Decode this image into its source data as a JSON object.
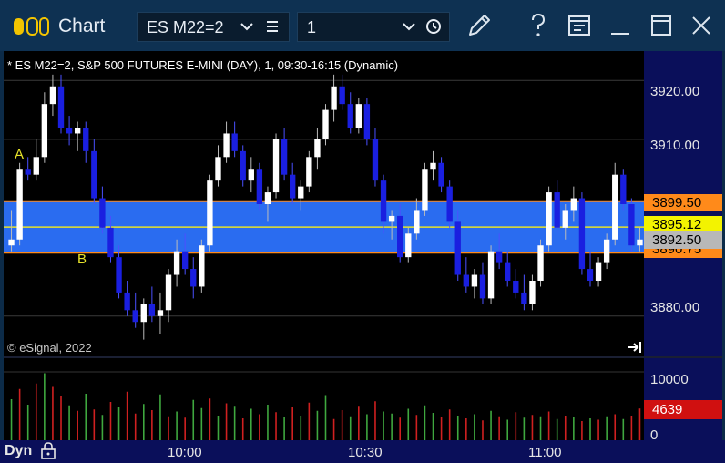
{
  "window": {
    "title": "Chart"
  },
  "toolbar": {
    "symbol": "ES M22=2",
    "interval": "1",
    "icons": [
      "chevron-down-icon",
      "list-icon",
      "chevron-down-icon",
      "clock-icon",
      "pencil-icon",
      "help-icon",
      "layout-icon",
      "minimize-icon",
      "maximize-icon",
      "close-icon"
    ]
  },
  "chart": {
    "study_title": "* ES M22=2, S&P 500 FUTURES E-MINI (DAY), 1, 09:30-16:15 (Dynamic)",
    "copyright": "© eSignal, 2022",
    "annotations": {
      "a": "A",
      "b": "B"
    },
    "price_labels": [
      "3920.00",
      "3910.00",
      "3880.00"
    ],
    "tags": {
      "upper": "3899.50",
      "middle": "3895.12",
      "last": "3892.50",
      "lower_partial": "3890.75"
    },
    "volume_labels": {
      "max": "10000",
      "last": "4639",
      "zero": "0"
    },
    "time_labels": [
      "10:00",
      "10:30",
      "11:00"
    ],
    "footer_mode": "Dyn",
    "colors": {
      "up": "#ffffff",
      "down": "#1a1fe0",
      "band": "#2a6cf0",
      "band_edge": "#ff8a1a",
      "midline": "#e7e32a",
      "vol_up": "#3fa83f",
      "vol_down": "#d02020"
    }
  },
  "chart_data": {
    "type": "candlestick",
    "ylim": [
      3873,
      3925
    ],
    "band": {
      "top": 3899.5,
      "bottom": 3890.75,
      "mid": 3895.12
    },
    "candles": [
      [
        3892,
        3898,
        3891,
        3893
      ],
      [
        3893,
        3906,
        3892,
        3905
      ],
      [
        3905,
        3907,
        3903,
        3904
      ],
      [
        3904,
        3910,
        3903,
        3907
      ],
      [
        3907,
        3918,
        3906,
        3916
      ],
      [
        3916,
        3921,
        3914,
        3919
      ],
      [
        3919,
        3921,
        3911,
        3912
      ],
      [
        3912,
        3914,
        3909,
        3911
      ],
      [
        3911,
        3913,
        3908,
        3912
      ],
      [
        3912,
        3913,
        3906,
        3908
      ],
      [
        3908,
        3910,
        3899,
        3900
      ],
      [
        3900,
        3902,
        3894,
        3895
      ],
      [
        3895,
        3897,
        3889,
        3890
      ],
      [
        3890,
        3892,
        3883,
        3884
      ],
      [
        3884,
        3886,
        3880,
        3881
      ],
      [
        3881,
        3884,
        3878,
        3879
      ],
      [
        3879,
        3883,
        3876,
        3882
      ],
      [
        3882,
        3885,
        3879,
        3880
      ],
      [
        3880,
        3884,
        3877,
        3881
      ],
      [
        3881,
        3888,
        3879,
        3887
      ],
      [
        3887,
        3893,
        3885,
        3891
      ],
      [
        3891,
        3894,
        3887,
        3888
      ],
      [
        3888,
        3890,
        3883,
        3885
      ],
      [
        3885,
        3893,
        3884,
        3892
      ],
      [
        3892,
        3904,
        3891,
        3903
      ],
      [
        3903,
        3909,
        3902,
        3907
      ],
      [
        3907,
        3913,
        3906,
        3911
      ],
      [
        3911,
        3913,
        3907,
        3908
      ],
      [
        3908,
        3909,
        3902,
        3903
      ],
      [
        3903,
        3907,
        3901,
        3905
      ],
      [
        3905,
        3906,
        3898,
        3899
      ],
      [
        3899,
        3902,
        3896,
        3901
      ],
      [
        3901,
        3911,
        3900,
        3910
      ],
      [
        3910,
        3912,
        3903,
        3904
      ],
      [
        3904,
        3906,
        3899,
        3900
      ],
      [
        3900,
        3903,
        3898,
        3902
      ],
      [
        3902,
        3908,
        3901,
        3907
      ],
      [
        3907,
        3912,
        3905,
        3910
      ],
      [
        3910,
        3916,
        3909,
        3915
      ],
      [
        3915,
        3921,
        3913,
        3919
      ],
      [
        3919,
        3921,
        3915,
        3916
      ],
      [
        3916,
        3918,
        3911,
        3912
      ],
      [
        3912,
        3917,
        3911,
        3916
      ],
      [
        3916,
        3917,
        3909,
        3910
      ],
      [
        3910,
        3912,
        3902,
        3903
      ],
      [
        3903,
        3904,
        3894,
        3896
      ],
      [
        3896,
        3898,
        3893,
        3897
      ],
      [
        3897,
        3899,
        3889,
        3890
      ],
      [
        3890,
        3895,
        3889,
        3894
      ],
      [
        3894,
        3900,
        3893,
        3898
      ],
      [
        3898,
        3906,
        3897,
        3905
      ],
      [
        3905,
        3908,
        3903,
        3906
      ],
      [
        3906,
        3907,
        3901,
        3902
      ],
      [
        3902,
        3903,
        3895,
        3896
      ],
      [
        3896,
        3898,
        3886,
        3887
      ],
      [
        3887,
        3890,
        3884,
        3885
      ],
      [
        3885,
        3888,
        3883,
        3887
      ],
      [
        3887,
        3889,
        3882,
        3883
      ],
      [
        3883,
        3892,
        3882,
        3891
      ],
      [
        3891,
        3894,
        3888,
        3889
      ],
      [
        3889,
        3891,
        3885,
        3886
      ],
      [
        3886,
        3888,
        3883,
        3884
      ],
      [
        3884,
        3887,
        3881,
        3882
      ],
      [
        3882,
        3887,
        3881,
        3886
      ],
      [
        3886,
        3893,
        3885,
        3892
      ],
      [
        3892,
        3902,
        3891,
        3901
      ],
      [
        3901,
        3903,
        3894,
        3895
      ],
      [
        3895,
        3899,
        3893,
        3898
      ],
      [
        3898,
        3902,
        3896,
        3900
      ],
      [
        3900,
        3901,
        3887,
        3888
      ],
      [
        3888,
        3891,
        3885,
        3886
      ],
      [
        3886,
        3890,
        3885,
        3889
      ],
      [
        3889,
        3894,
        3888,
        3893
      ],
      [
        3893,
        3906,
        3892,
        3904
      ],
      [
        3904,
        3905,
        3898,
        3899
      ],
      [
        3899,
        3900,
        3891,
        3892
      ],
      [
        3892,
        3895,
        3891,
        3893
      ]
    ],
    "volume": [
      [
        6000,
        1
      ],
      [
        7500,
        0
      ],
      [
        5200,
        1
      ],
      [
        8300,
        0
      ],
      [
        9800,
        1
      ],
      [
        7800,
        0
      ],
      [
        6400,
        0
      ],
      [
        5100,
        1
      ],
      [
        4300,
        0
      ],
      [
        6800,
        1
      ],
      [
        4500,
        0
      ],
      [
        3700,
        1
      ],
      [
        5600,
        0
      ],
      [
        4800,
        1
      ],
      [
        7100,
        0
      ],
      [
        3900,
        0
      ],
      [
        5300,
        1
      ],
      [
        4400,
        0
      ],
      [
        6700,
        1
      ],
      [
        3500,
        0
      ],
      [
        4200,
        1
      ],
      [
        3300,
        0
      ],
      [
        5900,
        1
      ],
      [
        4700,
        1
      ],
      [
        6100,
        0
      ],
      [
        3600,
        1
      ],
      [
        5400,
        0
      ],
      [
        4900,
        1
      ],
      [
        3200,
        0
      ],
      [
        4600,
        1
      ],
      [
        3800,
        0
      ],
      [
        5200,
        1
      ],
      [
        4100,
        0
      ],
      [
        3400,
        1
      ],
      [
        4800,
        0
      ],
      [
        3600,
        1
      ],
      [
        5500,
        0
      ],
      [
        4300,
        1
      ],
      [
        6600,
        1
      ],
      [
        3100,
        0
      ],
      [
        4400,
        0
      ],
      [
        3500,
        1
      ],
      [
        4900,
        0
      ],
      [
        3800,
        1
      ],
      [
        5700,
        0
      ],
      [
        4200,
        1
      ],
      [
        3900,
        1
      ],
      [
        3300,
        0
      ],
      [
        4600,
        1
      ],
      [
        3700,
        0
      ],
      [
        5100,
        1
      ],
      [
        4000,
        1
      ],
      [
        3400,
        0
      ],
      [
        4500,
        0
      ],
      [
        3600,
        1
      ],
      [
        3200,
        0
      ],
      [
        3800,
        1
      ],
      [
        2900,
        0
      ],
      [
        4300,
        1
      ],
      [
        3500,
        0
      ],
      [
        3000,
        1
      ],
      [
        4100,
        0
      ],
      [
        3300,
        1
      ],
      [
        3700,
        0
      ],
      [
        3500,
        1
      ],
      [
        4200,
        0
      ],
      [
        3100,
        1
      ],
      [
        3600,
        0
      ],
      [
        3400,
        1
      ],
      [
        2800,
        0
      ],
      [
        3200,
        1
      ],
      [
        3000,
        0
      ],
      [
        3500,
        1
      ],
      [
        3800,
        0
      ],
      [
        3100,
        1
      ],
      [
        3600,
        0
      ],
      [
        4639,
        0
      ]
    ],
    "volume_ylim": [
      0,
      12000
    ],
    "x_ticks": [
      "10:00",
      "10:30",
      "11:00"
    ]
  }
}
